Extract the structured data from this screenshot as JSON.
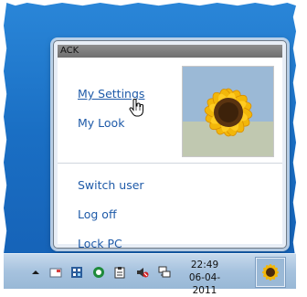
{
  "popup": {
    "title": "ACK",
    "menu": {
      "my_settings": "My Settings",
      "my_look": "My Look",
      "switch_user": "Switch user",
      "log_off": "Log off",
      "lock_pc": "Lock PC"
    },
    "avatar_icon": "sunflower-avatar"
  },
  "taskbar": {
    "time": "22:49",
    "date": "06-04-2011",
    "tray_icons": [
      "show-hidden-icons-arrow",
      "mail-icon",
      "app-grid-icon",
      "circle-app-icon",
      "clipboard-icon",
      "volume-muted-icon",
      "network-icon"
    ]
  },
  "colors": {
    "link": "#1e5aa8",
    "desktop": "#1a6fc4",
    "taskbar": "#a6c2de"
  }
}
